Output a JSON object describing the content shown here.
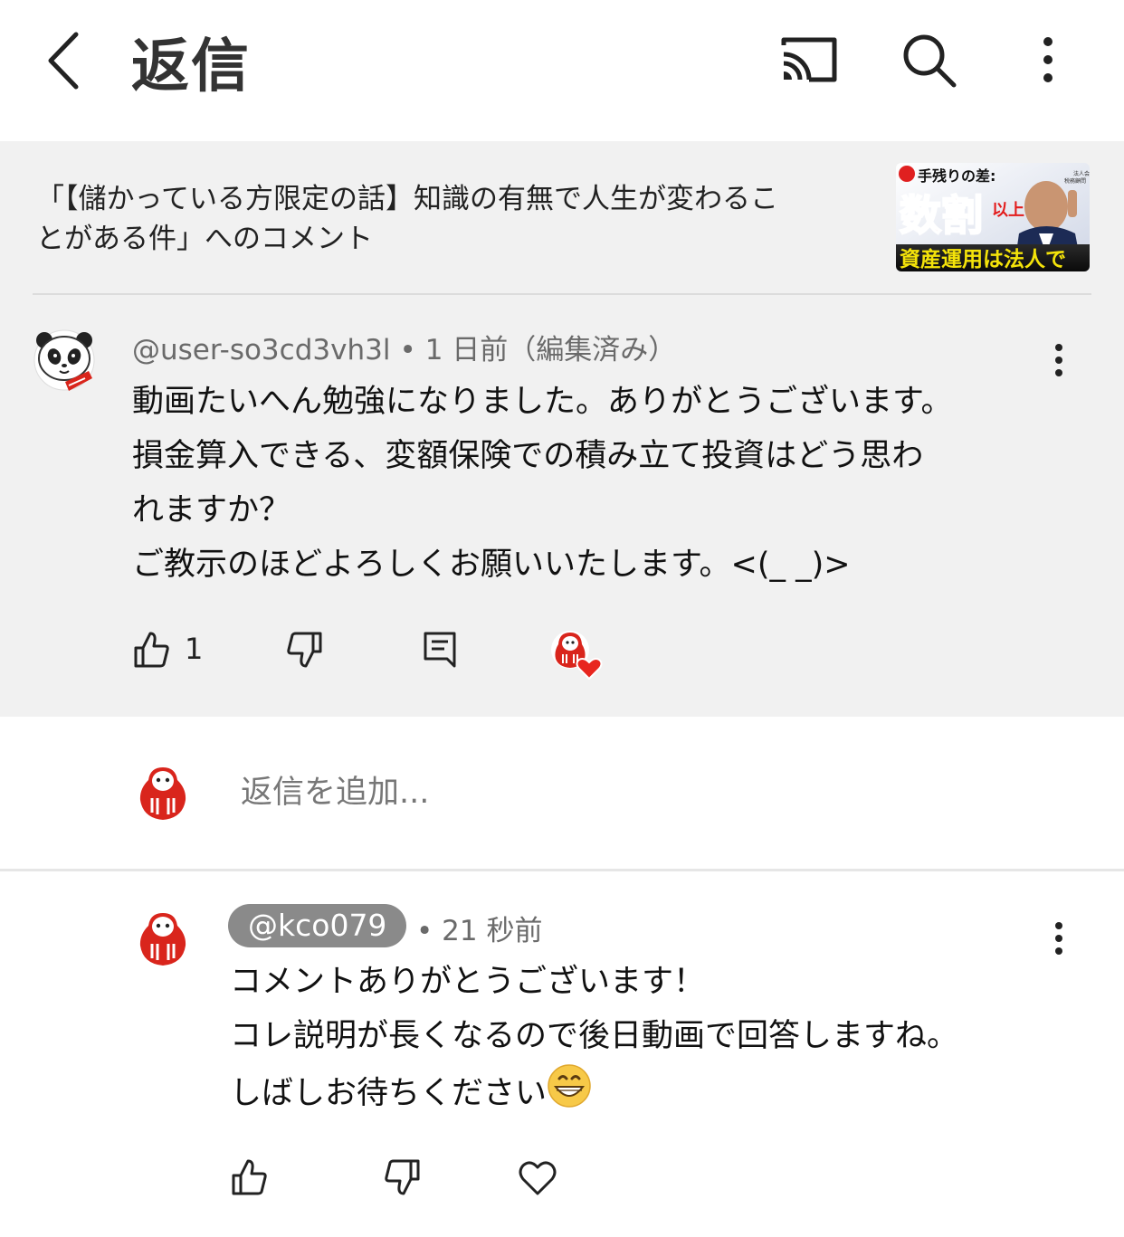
{
  "header": {
    "title": "返信",
    "icons": [
      "back-icon",
      "cast-icon",
      "search-icon",
      "more-vert-icon"
    ]
  },
  "video": {
    "title_line1": "「【儲かっている方限定の話】知識の有無で人生が変わるこ",
    "title_line2": "とがある件」へのコメント",
    "thumbnail": {
      "badge": "手残りの差:",
      "big": "数割",
      "side": "以上",
      "bottom": "資産運用は法人で",
      "small1": "法人会計",
      "small2": "税務顧問"
    }
  },
  "comment": {
    "author": "@user-so3cd3vh3l",
    "time": "1 日前（編集済み）",
    "lines": [
      "動画たいへん勉強になりました。ありがとうございます。",
      "損金算入できる、変額保険での積み立て投資はどう思わ",
      "れますか？",
      "ご教示のほどよろしくお願いいたします。<(_ _)>"
    ],
    "like_count": "1"
  },
  "reply_input": {
    "placeholder": "返信を追加..."
  },
  "reply": {
    "author": "@kco079",
    "time": "21 秒前",
    "lines": [
      "コメントありがとうございます！",
      "コレ説明が長くなるので後日動画で回答しますね。",
      "しばしお待ちください"
    ],
    "emoji": "grinning-face"
  },
  "colors": {
    "context_bg": "#f1f1f1",
    "chip_bg": "#8a8a8a",
    "heart_red": "#e8261f",
    "daruma_red": "#d9251c"
  }
}
